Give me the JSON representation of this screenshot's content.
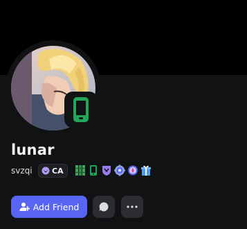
{
  "profile": {
    "display_name": "lunar",
    "username": "svzqi",
    "status": "mobile-online",
    "tag": {
      "label": "CA",
      "icon": "guild-tag-icon"
    },
    "badges": [
      "stacked-books-badge",
      "mobile-badge",
      "shield-badge",
      "gear-badge",
      "compass-badge",
      "gift-badge"
    ]
  },
  "actions": {
    "add_friend_label": "Add Friend",
    "message_icon": "chat-bubble-icon",
    "more_icon": "ellipsis-icon"
  },
  "colors": {
    "background": "#000000",
    "card": "#111214",
    "primary": "#5865f2",
    "online": "#23a55a",
    "secondary_button": "#2b2d31"
  }
}
